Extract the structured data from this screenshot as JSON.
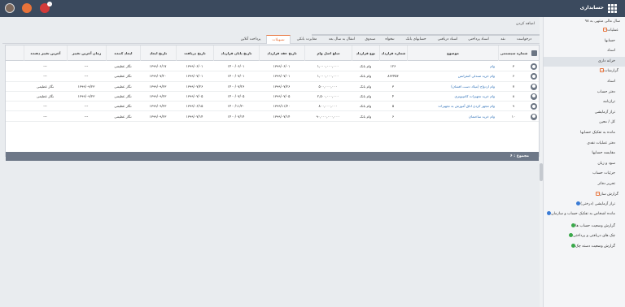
{
  "app": {
    "title": "حسابداری",
    "notification_count": "۱"
  },
  "sidebar": {
    "fiscal_year": "سال مالی منتهی به ۹۸",
    "items": [
      {
        "label": "عملیات",
        "type": "group"
      },
      {
        "label": "حسابها",
        "type": "item"
      },
      {
        "label": "اسناد",
        "type": "item"
      },
      {
        "label": "خزانه داری",
        "type": "item",
        "active": true
      },
      {
        "label": "گزارشات",
        "type": "group"
      },
      {
        "label": "اسناد",
        "type": "item"
      },
      {
        "label": "دفتر حساب",
        "type": "item"
      },
      {
        "label": "ترازنامه",
        "type": "item"
      },
      {
        "label": "تراز آزمایشی",
        "type": "item"
      },
      {
        "label": "کل / معین",
        "type": "item"
      },
      {
        "label": "مانده به تفکیک حسابها",
        "type": "item"
      },
      {
        "label": "دفتر عملیات نقدی",
        "type": "item"
      },
      {
        "label": "مقایسه حسابها",
        "type": "item"
      },
      {
        "label": "سود و زیان",
        "type": "item"
      },
      {
        "label": "جزئیات حساب",
        "type": "item"
      },
      {
        "label": "تحریر دفاتر",
        "type": "item"
      },
      {
        "label": "گزارش ساز",
        "type": "group"
      },
      {
        "label": "تراز آزمایشی (درختی)",
        "type": "report",
        "color": "#3a7bd5"
      },
      {
        "label": "مانده اشخاص به تفکیک حساب و سازمان",
        "type": "report",
        "color": "#3a7bd5"
      },
      {
        "label": "گزارش وضعیت حساب ها",
        "type": "report",
        "color": "#3aa84a"
      },
      {
        "label": "چک های دریافتی و پرداختی",
        "type": "report",
        "color": "#3aa84a"
      },
      {
        "label": "گزارش وضعیت دسته چک",
        "type": "report",
        "color": "#3aa84a"
      }
    ]
  },
  "main": {
    "add_label": "اضافه کردن",
    "tabs": [
      "درخواست",
      "نقد",
      "اسناد پرداختی",
      "اسناد دریافتی",
      "حسابهای بانک",
      "تنخواه",
      "صندوق",
      "انتقال به سال بعد",
      "مغایرت بانکی",
      "تسهیلات",
      "پرداخت آنلاین"
    ],
    "active_tab": "تسهیلات",
    "columns": [
      "شماره سیستمی",
      "موضوع",
      "شماره قرارداد",
      "نوع قرارداد",
      "مبلغ اصل وام",
      "تاریخ عقد قرارداد",
      "تاریخ پایان قرارداد",
      "تاریخ دریافت",
      "تاریخ ایجاد",
      "ایجاد کننده",
      "زمان آخرین تغییر",
      "آخرین تغییر دهنده"
    ],
    "rows": [
      [
        "۳",
        "وام",
        "۱۲۶",
        "وام بانک",
        "۱,۰۰۰,۰۰۰,۰۰۰",
        "۱۳۹۹/۰۶/۰۱",
        "۱۴۰۰/۰۶/۰۱",
        "۱۳۹۹/۰۶/۰۱",
        "۱۳۹۹/۰۶/۱۷",
        "نگار عظیمی",
        "---",
        "---"
      ],
      [
        "۶",
        "وام خرید صندلی کنفرانس",
        "۸۶۲۴۵۳",
        "وام بانک",
        "۱,۰۰۰,۰۰۰,۰۰۰",
        "۱۳۹۹/۰۷/۰۱",
        "۱۴۰۰/۰۷/۰۱",
        "۱۳۹۹/۰۷/۰۱",
        "۱۳۹۹/۰۷/۲۰",
        "نگار عظیمی",
        "---",
        "---"
      ],
      [
        "۷",
        "وام ازدواج (میلاد دست افشان)",
        "۳",
        "وام بانک",
        "۵۰۰,۰۰۰,۰۰۰",
        "۱۳۹۹/۰۷/۲۶",
        "۱۴۰۰/۰۷/۲۶",
        "۱۳۹۹/۰۷/۲۶",
        "۱۳۹۹/۰۹/۲۳",
        "نگار عظیمی",
        "۱۳۹۹/۰۹/۲۳",
        "نگار عظیمی"
      ],
      [
        "۸",
        "وام خرید تجهیزات کامپیوتری",
        "۴",
        "وام بانک",
        "۲,۵۰۰,۰۰۰,۰۰۰",
        "۱۳۹۹/۰۷/۰۵",
        "۱۴۰۰/۰۷/۰۵",
        "۱۳۹۹/۰۷/۰۵",
        "۱۳۹۹/۰۹/۲۳",
        "نگار عظیمی",
        "۱۳۹۹/۰۹/۲۳",
        "نگار عظیمی"
      ],
      [
        "۹",
        "وام مجهز کردن اتاق آموزش به تجهیزات",
        "۵",
        "وام بانک",
        "۸۰۰,۰۰۰,۰۰۰",
        "۱۳۹۹/۱۱/۳۰",
        "۱۴۰۰/۱۱/۳۰",
        "۱۳۹۹/۰۶/۱۵",
        "۱۳۹۹/۰۹/۲۳",
        "نگار عظیمی",
        "---",
        "---"
      ],
      [
        "۱۰",
        "وام خرید ساختمان",
        "۶",
        "وام بانک",
        "۹۰,۰۰۰,۰۰۰,۰۰۰",
        "۱۳۹۹/۰۷/۱۴",
        "۱۴۰۰/۰۷/۱۴",
        "۱۳۹۹/۰۷/۱۴",
        "۱۳۹۹/۰۹/۲۳",
        "نگار عظیمی",
        "---",
        "---"
      ]
    ],
    "sum_label": "مجموع : ۶"
  }
}
